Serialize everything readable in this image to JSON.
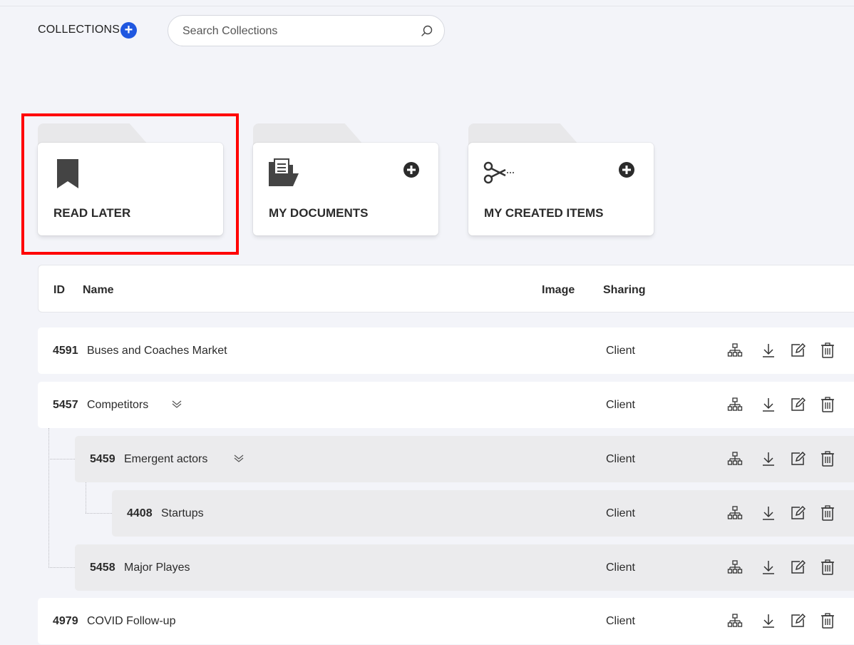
{
  "header": {
    "collections_label": "COLLECTIONS",
    "add_icon": "plus-circle-icon",
    "search": {
      "placeholder": "Search Collections",
      "value": "",
      "icon": "search-icon"
    }
  },
  "folders": [
    {
      "title": "READ LATER",
      "icon": "bookmark-icon",
      "highlighted": true
    },
    {
      "title": "MY DOCUMENTS",
      "icon": "folder-document-icon",
      "add_icon": "plus-circle-icon"
    },
    {
      "title": "MY CREATED ITEMS",
      "icon": "scissors-icon",
      "add_icon": "plus-circle-icon"
    }
  ],
  "table": {
    "columns": {
      "id": "ID",
      "name": "Name",
      "image": "Image",
      "sharing": "Sharing"
    },
    "rows": [
      {
        "id": "4591",
        "name": "Buses and Coaches Market",
        "sharing": "Client",
        "level": 0
      },
      {
        "id": "5457",
        "name": "Competitors",
        "sharing": "Client",
        "level": 0,
        "expanded": true
      },
      {
        "id": "5459",
        "name": "Emergent actors",
        "sharing": "Client",
        "level": 1,
        "expanded": true
      },
      {
        "id": "4408",
        "name": "Startups",
        "sharing": "Client",
        "level": 2
      },
      {
        "id": "5458",
        "name": "Major Playes",
        "sharing": "Client",
        "level": 1
      },
      {
        "id": "4979",
        "name": "COVID Follow-up",
        "sharing": "Client",
        "level": 0
      }
    ],
    "row_actions": [
      "hierarchy-icon",
      "download-icon",
      "edit-icon",
      "delete-icon"
    ]
  },
  "colors": {
    "accent": "#1f57e0",
    "highlight": "#ff0000",
    "background": "#f3f4f9",
    "nested_row": "#ebebed"
  }
}
